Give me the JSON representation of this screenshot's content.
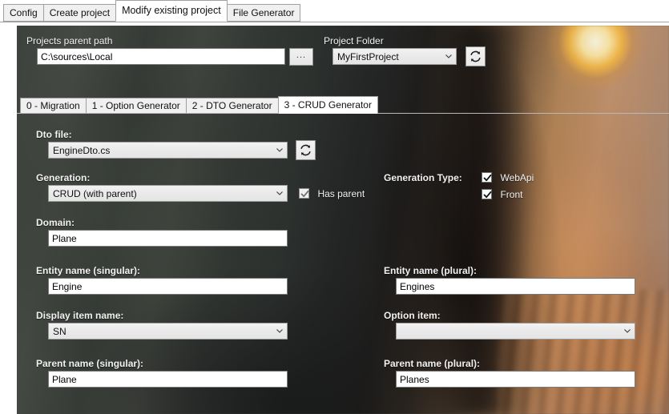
{
  "window": {
    "main_tabs": [
      {
        "label": "Config",
        "active": false
      },
      {
        "label": "Create project",
        "active": false
      },
      {
        "label": "Modify existing project",
        "active": true
      },
      {
        "label": "File Generator",
        "active": false
      }
    ]
  },
  "header": {
    "parent_path_label": "Projects parent path",
    "parent_path_value": "C:\\sources\\Local",
    "browse_label": "...",
    "project_folder_label": "Project Folder",
    "project_folder_value": "MyFirstProject",
    "refresh_icon": "refresh-icon"
  },
  "sub_tabs": [
    {
      "label": "0 - Migration",
      "active": false
    },
    {
      "label": "1 - Option Generator",
      "active": false
    },
    {
      "label": "2 - DTO Generator",
      "active": false
    },
    {
      "label": "3 - CRUD Generator",
      "active": true
    }
  ],
  "crud": {
    "dto_file_label": "Dto file:",
    "dto_file_value": "EngineDto.cs",
    "dto_refresh_icon": "refresh-icon",
    "generation_label": "Generation:",
    "generation_value": "CRUD (with parent)",
    "has_parent_label": "Has parent",
    "has_parent_checked": true,
    "generation_type_label": "Generation Type:",
    "generation_types": [
      {
        "label": "WebApi",
        "checked": true
      },
      {
        "label": "Front",
        "checked": true
      }
    ],
    "domain_label": "Domain:",
    "domain_value": "Plane",
    "entity_singular_label": "Entity name (singular):",
    "entity_singular_value": "Engine",
    "entity_plural_label": "Entity name (plural):",
    "entity_plural_value": "Engines",
    "display_item_label": "Display item name:",
    "display_item_value": "SN",
    "option_item_label": "Option item:",
    "option_item_value": "",
    "parent_singular_label": "Parent name (singular):",
    "parent_singular_value": "Plane",
    "parent_plural_label": "Parent name (plural):",
    "parent_plural_value": "Planes"
  },
  "colors": {
    "tab_active_bg": "#ffffff",
    "tab_inactive_bg": "#f0f0f0",
    "label_text": "#f2f2f2",
    "textbox_bg": "#ffffff",
    "combo_bg": "#eaeaea"
  }
}
